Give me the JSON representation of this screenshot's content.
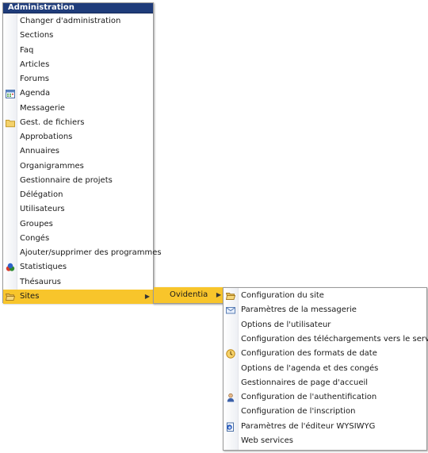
{
  "menu": {
    "title": "Administration",
    "items": [
      {
        "label": "Changer d'administration",
        "icon": ""
      },
      {
        "label": "Sections",
        "icon": ""
      },
      {
        "label": "Faq",
        "icon": ""
      },
      {
        "label": "Articles",
        "icon": ""
      },
      {
        "label": "Forums",
        "icon": ""
      },
      {
        "label": "Agenda",
        "icon": "calendar-icon"
      },
      {
        "label": "Messagerie",
        "icon": ""
      },
      {
        "label": "Gest. de fichiers",
        "icon": "folder-icon"
      },
      {
        "label": "Approbations",
        "icon": ""
      },
      {
        "label": "Annuaires",
        "icon": ""
      },
      {
        "label": "Organigrammes",
        "icon": ""
      },
      {
        "label": "Gestionnaire de projets",
        "icon": ""
      },
      {
        "label": "Délégation",
        "icon": ""
      },
      {
        "label": "Utilisateurs",
        "icon": ""
      },
      {
        "label": "Groupes",
        "icon": ""
      },
      {
        "label": "Congés",
        "icon": ""
      },
      {
        "label": "Ajouter/supprimer des programmes",
        "icon": ""
      },
      {
        "label": "Statistiques",
        "icon": "statistics-icon"
      },
      {
        "label": "Thésaurus",
        "icon": ""
      },
      {
        "label": "Sites",
        "icon": "open-folder-icon",
        "active": true,
        "has_submenu": true
      }
    ]
  },
  "sites_submenu": {
    "items": [
      {
        "label": "Ovidentia",
        "active": true,
        "has_submenu": true
      }
    ]
  },
  "ovidentia_submenu": {
    "items": [
      {
        "label": "Configuration du site",
        "icon": "open-folder-icon"
      },
      {
        "label": "Paramètres de la messagerie",
        "icon": "envelope-icon"
      },
      {
        "label": "Options de l'utilisateur",
        "icon": ""
      },
      {
        "label": "Configuration des téléchargements vers le serveur",
        "icon": ""
      },
      {
        "label": "Configuration des formats de date",
        "icon": "clock-icon"
      },
      {
        "label": "Options de l'agenda et des congés",
        "icon": ""
      },
      {
        "label": "Gestionnaires de page d'accueil",
        "icon": ""
      },
      {
        "label": "Configuration de l'authentification",
        "icon": "user-icon"
      },
      {
        "label": "Configuration de l'inscription",
        "icon": ""
      },
      {
        "label": "Paramètres de l'éditeur WYSIWYG",
        "icon": "editor-icon"
      },
      {
        "label": "Web services",
        "icon": ""
      }
    ]
  },
  "colors": {
    "header_bg": "#1f3c7a",
    "highlight": "#f8c52b"
  }
}
